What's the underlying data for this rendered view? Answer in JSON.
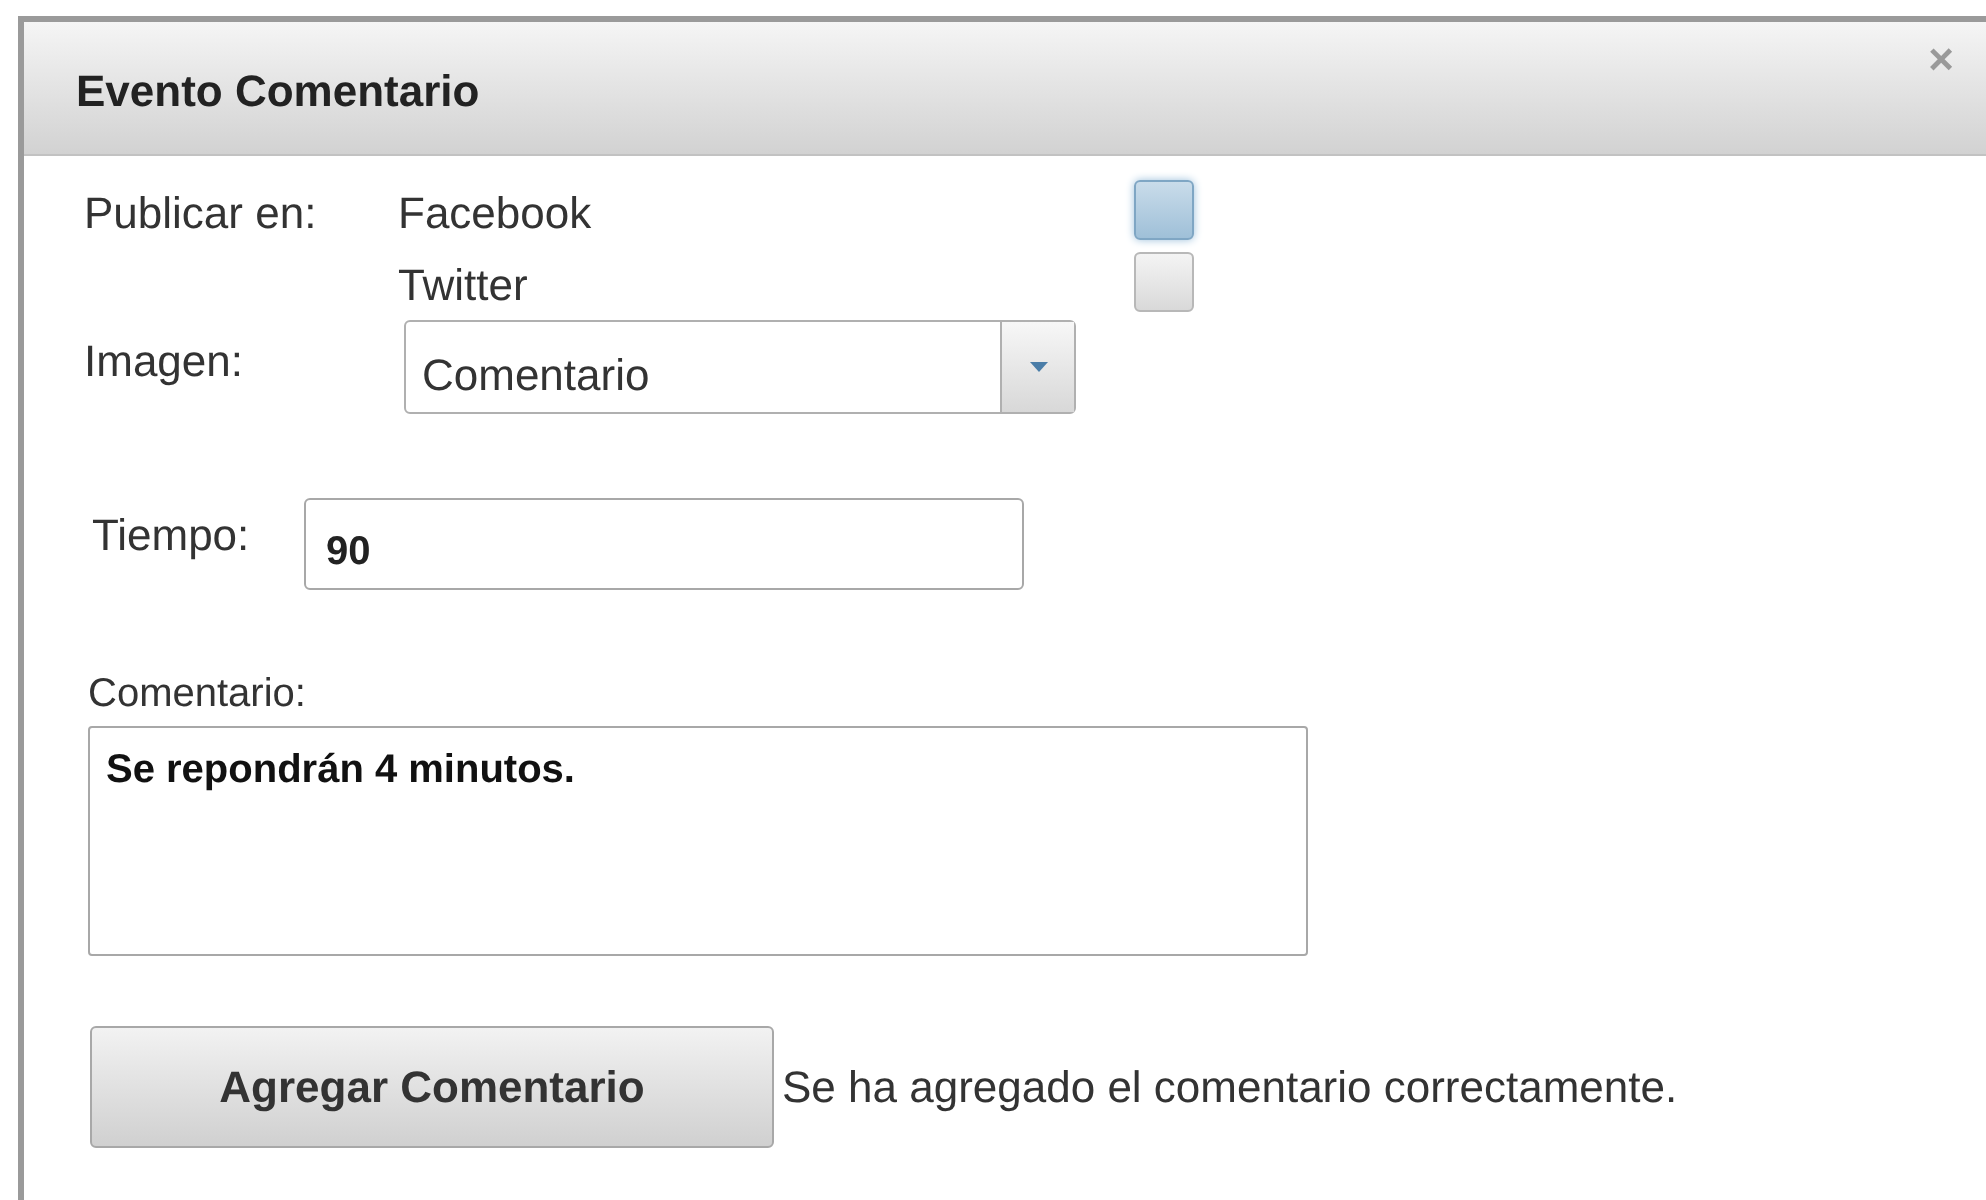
{
  "dialog": {
    "title": "Evento Comentario",
    "close": "×"
  },
  "publish": {
    "label": "Publicar en:",
    "networks": [
      {
        "name": "Facebook",
        "checked": false,
        "focused": true
      },
      {
        "name": "Twitter",
        "checked": false,
        "focused": false
      }
    ]
  },
  "image": {
    "label": "Imagen:",
    "value": "Comentario"
  },
  "time": {
    "label": "Tiempo:",
    "value": "90"
  },
  "comment": {
    "label": "Comentario:",
    "value": "Se repondrán 4 minutos."
  },
  "submit": {
    "label": "Agregar Comentario"
  },
  "message": "Se ha agregado el comentario correctamente."
}
